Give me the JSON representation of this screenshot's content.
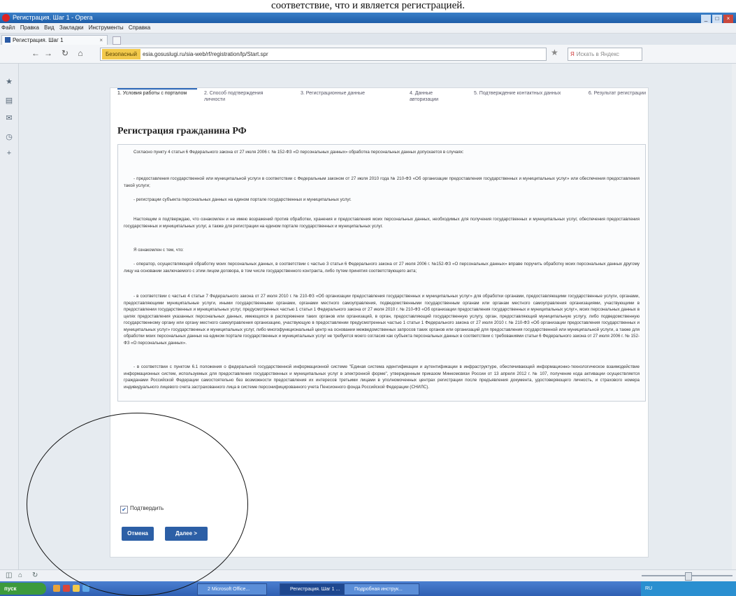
{
  "caption": "соответствие, что и является регистрацией.",
  "window": {
    "title": "Регистрация. Шаг 1 - Opera"
  },
  "menu": [
    "Файл",
    "Правка",
    "Вид",
    "Закладки",
    "Инструменты",
    "Справка"
  ],
  "tab": {
    "label": "Регистрация. Шаг 1",
    "close": "×"
  },
  "nav": {
    "back": "←",
    "forward": "→",
    "reload": "↻",
    "home": "⌂",
    "secure_label": "Безопасный",
    "url": "esia.gosuslugi.ru/sia-web/rf/registration/lp/Start.spr",
    "star": "★",
    "search_placeholder": "Искать в Яндекс"
  },
  "steps": [
    "1. Условия работы с порталом",
    "2. Способ подтверждения личности",
    "3. Регистрационные данные",
    "4. Данные авторизации",
    "5. Подтверждение контактных данных",
    "6. Результат регистрации"
  ],
  "heading": "Регистрация гражданина РФ",
  "paragraphs": [
    "Согласно пункту 4 статьи 6 Федерального закона от 27 июля 2006 г. № 152-ФЗ «О персональных данных» обработка персональных данных допускается в случаях:",
    "- предоставления государственной или муниципальной услуги в соответствии с Федеральным законом от 27 июля 2010 года № 210-ФЗ «Об организации предоставления государственных и муниципальных услуг» или обеспечения предоставления такой услуги;",
    "- регистрации субъекта персональных данных на едином портале государственных и муниципальных услуг.",
    "Настоящим я подтверждаю, что ознакомлен и не имею возражений против обработки, хранения и предоставления моих персональных данных, необходимых для получения государственных и муниципальных услуг, обеспечения предоставления государственных и муниципальных услуг, а также для регистрации на едином портале государственных и муниципальных услуг.",
    "Я ознакомлен с тем, что:",
    "- оператор, осуществляющий обработку моих персональных данных, в соответствии с частью 3 статьи 6 Федерального закона от 27 июля 2006 г. №152-ФЗ «О персональных данных» вправе поручить обработку моих персональных данных другому лицу на основании заключаемого с этим лицом договора, в том числе государственного контракта, либо путем принятия соответствующего акта;",
    "- в соответствии с частью 4 статьи 7 Федерального закона от 27 июля 2010 г. № 210-ФЗ «Об организации предоставления государственных и муниципальных услуг» для обработки органами, предоставляющими государственные услуги, органами, предоставляющими муниципальные услуги, иными государственными органами, органами местного самоуправления, подведомственными государственным органам или органам местного самоуправления организациями, участвующими в предоставлении государственных и муниципальных услуг, предусмотренных частью 1 статьи 1 Федерального закона от 27 июля 2010 г. № 210-ФЗ «Об организации предоставления государственных и муниципальных услуг», моих персональных данных в целях предоставления указанных персональных данных, имеющихся в распоряжении таких органов или организаций, в орган, предоставляющий государственную услугу, орган, предоставляющий муниципальную услугу, либо подведомственную государственному органу или органу местного самоуправления организацию, участвующую в предоставлении предусмотренных частью 1 статьи 1 Федерального закона от 27 июля 2010 г. № 210-ФЗ «Об организации предоставления государственных и муниципальных услуг» государственных и муниципальных услуг, либо многофункциональный центр на основании межведомственных запросов таких органов или организаций для предоставления государственной или муниципальной услуги, а также для обработки моих персональных данных на едином портале государственных и муниципальных услуг не требуется моего согласия как субъекта персональных данных в соответствии с требованиями статьи 6 Федерального закона от 27 июля 2006 г. № 152-ФЗ «О персональных данных».",
    "- в соответствии с пунктом 6.1 положения о федеральной государственной информационной системе \"Единая система идентификации и аутентификации в инфраструктуре, обеспечивающей информационно-технологическое взаимодействие информационных систем, используемых для предоставления государственных и муниципальных услуг в электронной форме\", утвержденным приказом Минкомсвязи России от 13 апреля 2012 г. № 107, получение кода активации осуществляется гражданами Российской Федерации самостоятельно без возможности предоставления их интересов третьими лицами в уполномоченных центрах регистрации после предъявления документа, удостоверяющего личность, и страхового номера индивидуального лицевого счета застрахованного лица в системе персонифицированного учета Пенсионного фонда Российской Федерации (СНИЛС)."
  ],
  "confirm": {
    "label": "Подтвердить",
    "checked": true
  },
  "buttons": {
    "cancel": "Отмена",
    "next": "Далее >"
  },
  "taskbar": {
    "start": "пуск",
    "tasks": [
      "2 Microsoft Office...",
      "Регистрация. Шаг 1 ...",
      "Подробная инструк..."
    ],
    "tray_lang": "RU"
  },
  "colors": {
    "accent": "#2c5fa6",
    "titlebar": "#1f5ea8",
    "secure": "#f2c94c"
  }
}
